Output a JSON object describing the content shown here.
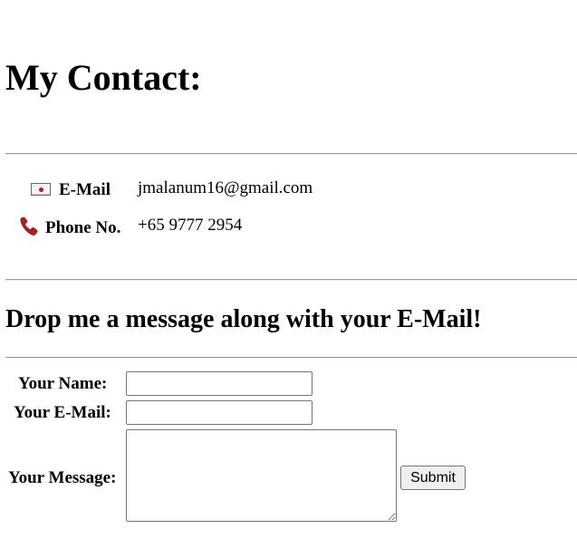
{
  "header": {
    "title": "My Contact:"
  },
  "contact": {
    "email": {
      "icon": "envelope-icon",
      "label": "E-Mail",
      "value": "jmalanum16@gmail.com"
    },
    "phone": {
      "icon": "telephone-receiver-icon",
      "label": "Phone No.",
      "value": "+65 9777 2954"
    }
  },
  "message_section": {
    "heading": "Drop me a message along with your E-Mail!"
  },
  "form": {
    "name_label": "Your Name:",
    "name_value": "",
    "email_label": "Your E-Mail:",
    "email_value": "",
    "message_label": "Your Message:",
    "message_value": "",
    "submit_label": "Submit"
  },
  "colors": {
    "phone_icon": "#c81414",
    "envelope_seal": "#d01010",
    "rule": "#9a9a9a"
  }
}
